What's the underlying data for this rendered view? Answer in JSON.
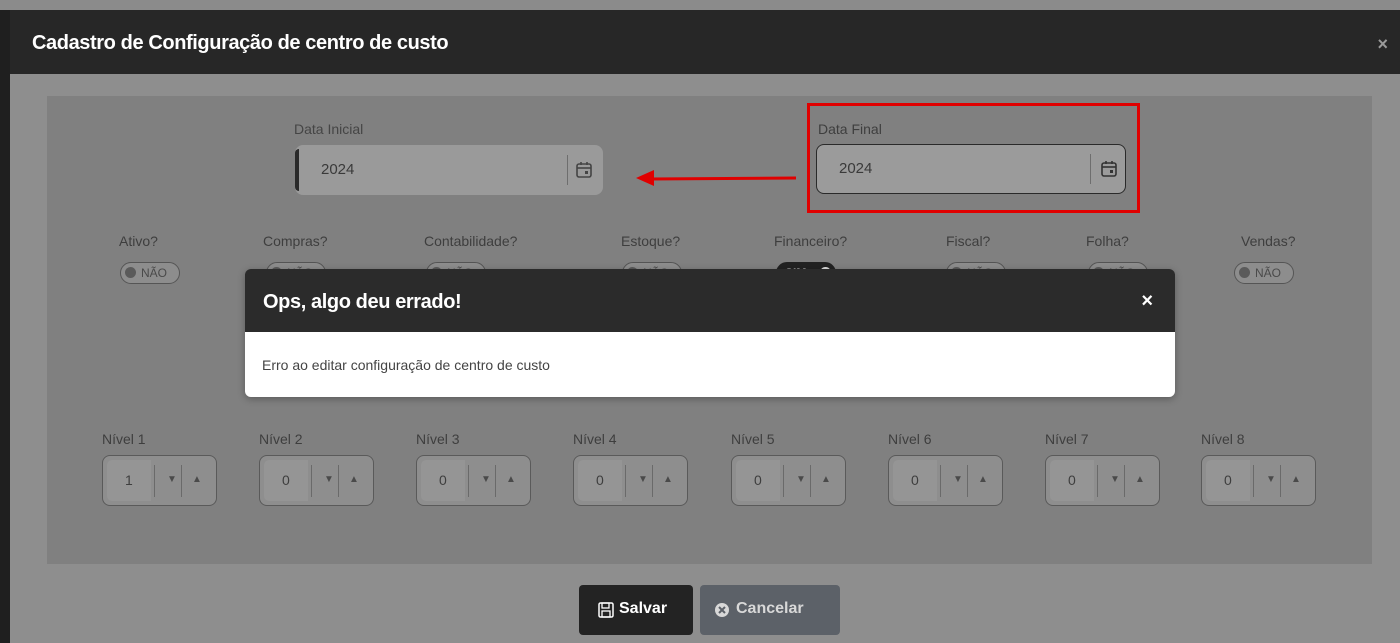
{
  "modal": {
    "title": "Cadastro de Configuração de centro de custo",
    "close": "×"
  },
  "dates": {
    "initial": {
      "label": "Data Inicial",
      "value": "2024"
    },
    "final": {
      "label": "Data Final",
      "value": "2024"
    }
  },
  "toggles": [
    {
      "label": "Ativo?",
      "state": "NÃO"
    },
    {
      "label": "Compras?",
      "state": "NÃO"
    },
    {
      "label": "Contabilidade?",
      "state": "NÃO"
    },
    {
      "label": "Estoque?",
      "state": "NÃO"
    },
    {
      "label": "Financeiro?",
      "state": "SIM"
    },
    {
      "label": "Fiscal?",
      "state": "NÃO"
    },
    {
      "label": "Folha?",
      "state": "NÃO"
    },
    {
      "label": "Vendas?",
      "state": "NÃO"
    }
  ],
  "niveis": [
    {
      "label": "Nível 1",
      "value": "1"
    },
    {
      "label": "Nível 2",
      "value": "0"
    },
    {
      "label": "Nível 3",
      "value": "0"
    },
    {
      "label": "Nível 4",
      "value": "0"
    },
    {
      "label": "Nível 5",
      "value": "0"
    },
    {
      "label": "Nível 6",
      "value": "0"
    },
    {
      "label": "Nível 7",
      "value": "0"
    },
    {
      "label": "Nível 8",
      "value": "0"
    }
  ],
  "buttons": {
    "save": "Salvar",
    "cancel": "Cancelar"
  },
  "alert": {
    "title": "Ops, algo deu errado!",
    "close": "×",
    "message": "Erro ao editar configuração de centro de custo"
  },
  "colors": {
    "annotation": "#e00000",
    "header": "#272727",
    "overlay": "#898989"
  }
}
